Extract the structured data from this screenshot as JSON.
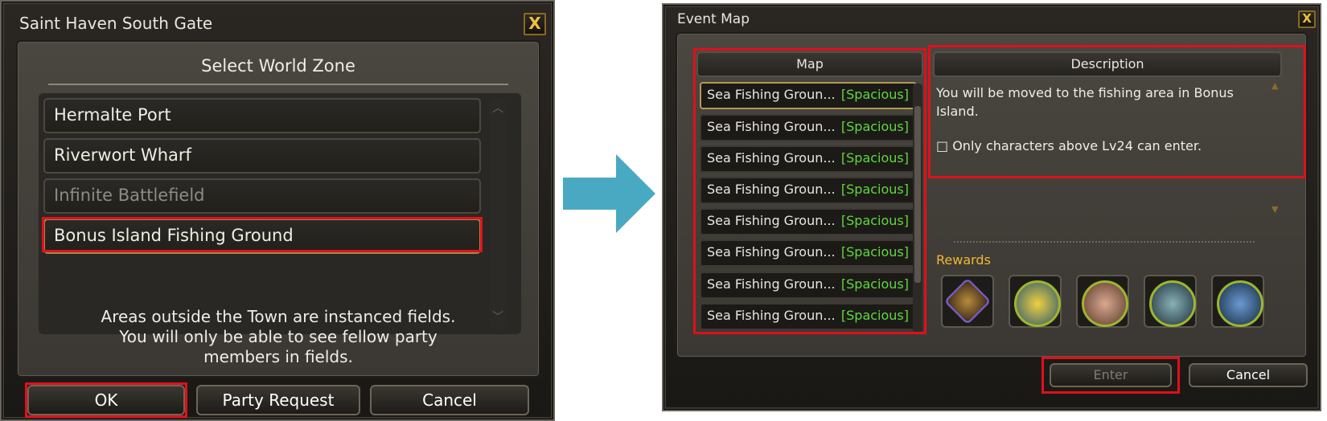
{
  "left_dialog": {
    "title": "Saint Haven South Gate",
    "close_glyph": "X",
    "heading": "Select World Zone",
    "zones": [
      {
        "label": "Hermalte Port",
        "state": "normal"
      },
      {
        "label": "Riverwort Wharf",
        "state": "normal"
      },
      {
        "label": "Infinite Battlefield",
        "state": "disabled"
      },
      {
        "label": "Bonus Island Fishing Ground",
        "state": "selected"
      }
    ],
    "notice_lines": [
      "Areas outside the Town are instanced fields.",
      "You will only be able to see fellow party",
      "members in fields."
    ],
    "buttons": {
      "ok": "OK",
      "party_request": "Party Request",
      "cancel": "Cancel"
    }
  },
  "arrow_color": "#4aa9c2",
  "right_dialog": {
    "title": "Event Map",
    "close_glyph": "X",
    "map_header": "Map",
    "description_header": "Description",
    "maps": [
      {
        "name": "Sea Fishing Groun...",
        "status": "[Spacious]"
      },
      {
        "name": "Sea Fishing Groun...",
        "status": "[Spacious]"
      },
      {
        "name": "Sea Fishing Groun...",
        "status": "[Spacious]"
      },
      {
        "name": "Sea Fishing Groun...",
        "status": "[Spacious]"
      },
      {
        "name": "Sea Fishing Groun...",
        "status": "[Spacious]"
      },
      {
        "name": "Sea Fishing Groun...",
        "status": "[Spacious]"
      },
      {
        "name": "Sea Fishing Groun...",
        "status": "[Spacious]"
      },
      {
        "name": "Sea Fishing Groun...",
        "status": "[Spacious]"
      }
    ],
    "description_line1": "You will be moved to the fishing area in Bonus",
    "description_line2": "Island.",
    "requirement": "□ Only characters above Lv24 can enter.",
    "rewards_label": "Rewards",
    "rewards": [
      "pouch-icon",
      "tropical-fish-icon",
      "octopus-icon",
      "sea-turtle-icon",
      "catfish-icon"
    ],
    "buttons": {
      "enter": "Enter",
      "cancel": "Cancel"
    }
  },
  "colors": {
    "status_green": "#5fd83c",
    "rewards_gold": "#f0b830",
    "highlight_red": "#e0101a"
  }
}
